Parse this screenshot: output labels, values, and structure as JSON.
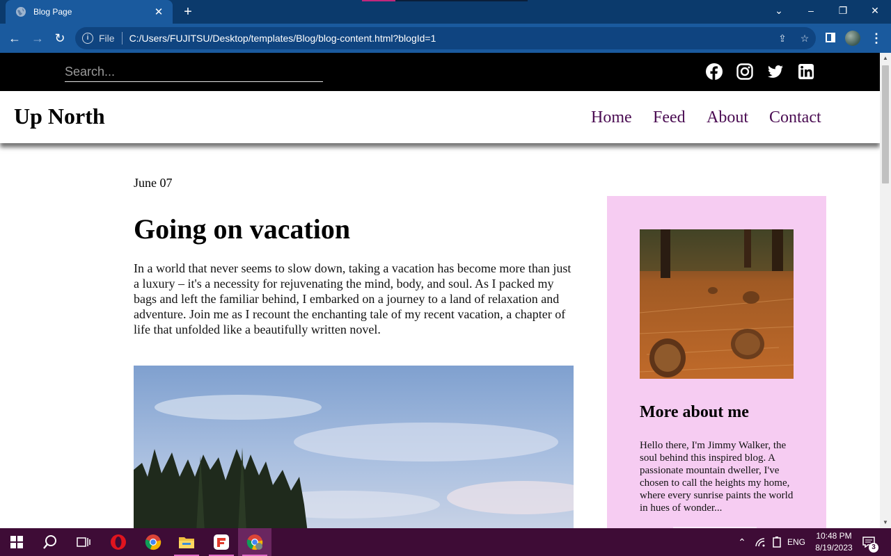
{
  "browser": {
    "tab_title": "Blog Page",
    "file_label": "File",
    "url": "C:/Users/FUJITSU/Desktop/templates/Blog/blog-content.html?blogId=1"
  },
  "search": {
    "placeholder": "Search..."
  },
  "social_icons": [
    "facebook-icon",
    "instagram-icon",
    "twitter-icon",
    "linkedin-icon"
  ],
  "site": {
    "logo": "Up North"
  },
  "nav": [
    "Home",
    "Feed",
    "About",
    "Contact"
  ],
  "post": {
    "date": "June 07",
    "title": "Going on vacation",
    "body": "In a world that never seems to slow down, taking a vacation has become more than just a luxury – it's a necessity for rejuvenating the mind, body, and soul. As I packed my bags and left the familiar behind, I embarked on a journey to a land of relaxation and adventure. Join me as I recount the enchanting tale of my recent vacation, a chapter of life that unfolded like a beautifully written novel."
  },
  "sidebar": {
    "heading": "More about me",
    "text": "Hello there, I'm Jimmy Walker, the soul behind this inspired blog. A passionate mountain dweller, I've chosen to call the heights my home, where every sunrise paints the world in hues of wonder..."
  },
  "taskbar": {
    "language": "ENG",
    "time": "10:48 PM",
    "date": "8/19/2023",
    "notifications": "3"
  },
  "colors": {
    "nav_link": "#4a0c52",
    "sidebar_bg": "#f6ccf2",
    "taskbar_bg": "#3e0c36",
    "browser_bg": "#1a5a9e"
  }
}
